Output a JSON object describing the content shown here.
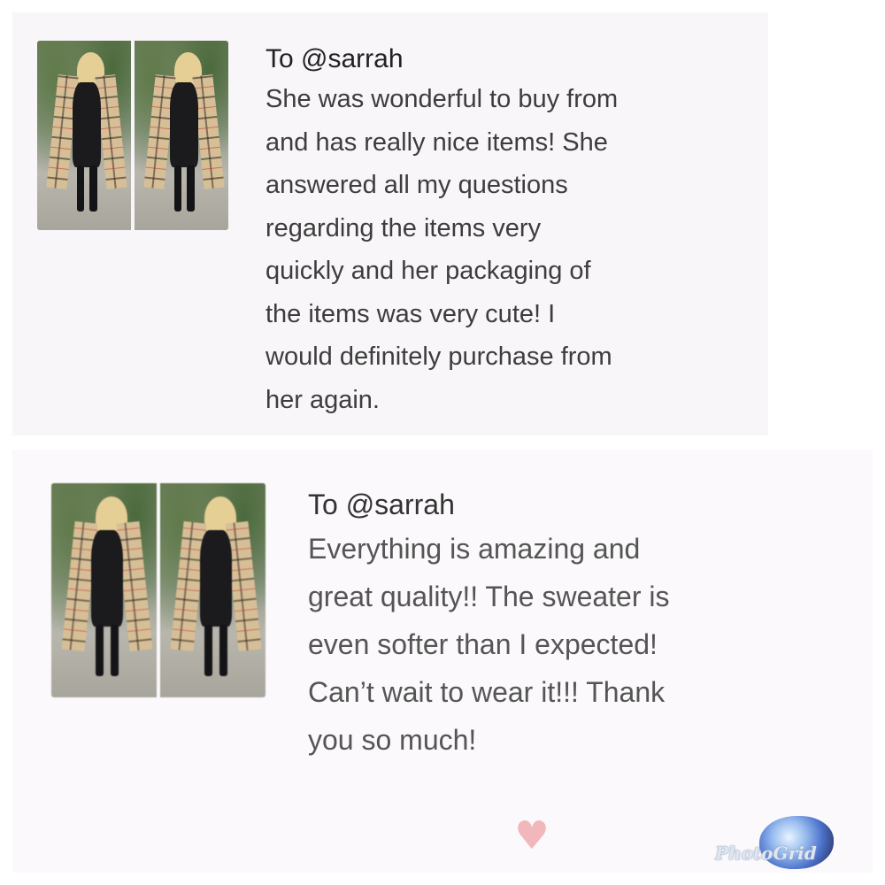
{
  "reviews": [
    {
      "recipient": "To @sarrah",
      "lines": [
        "She was wonderful to buy from",
        "and has really nice items! She",
        "answered all my questions",
        "regarding the items very",
        "quickly and her packaging of",
        "the items was very cute! I",
        "would definitely purchase from",
        "her again."
      ]
    },
    {
      "recipient": "To @sarrah",
      "lines": [
        "Everything is amazing and",
        "great quality!! The sweater is",
        "even softer than I expected!",
        "Can’t wait to wear it!!! Thank",
        "you so much!"
      ]
    }
  ],
  "watermark": {
    "text": "PhotoGrid"
  },
  "icons": {
    "like": "heart-icon",
    "watermark_logo": "photogrid-logo-icon"
  },
  "colors": {
    "card_bg": "#f8f6f8",
    "heart": "#f1b7bb",
    "text": "#3d3d3d"
  }
}
